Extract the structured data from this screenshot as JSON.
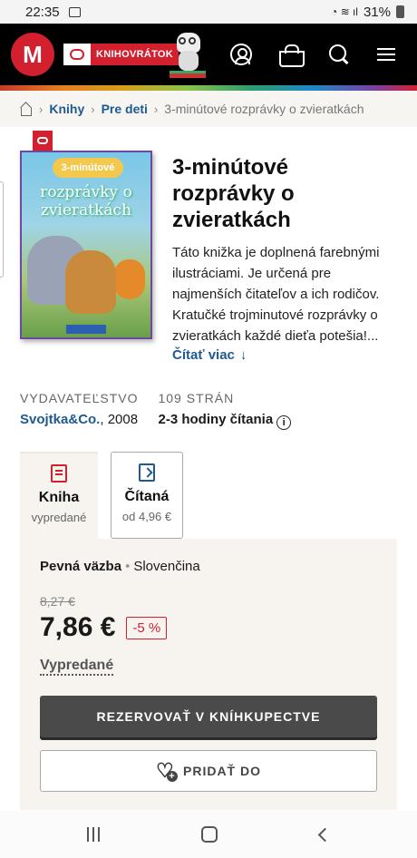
{
  "status_bar": {
    "time": "22:35",
    "battery": "31%"
  },
  "header": {
    "brand_text": "KNIHOVRÁTOK",
    "logo_letter": "M"
  },
  "breadcrumb": {
    "items": [
      {
        "label": "Knihy"
      },
      {
        "label": "Pre deti"
      }
    ],
    "current": "3-minútové rozprávky o zvieratkách"
  },
  "product": {
    "title": "3-minútové rozprávky o zvieratkách",
    "cover_title": "rozprávky o zvieratkách",
    "cover_top": "3-minútové",
    "description": "Táto knižka je doplnená farebnými ilustráciami. Je určená pre najmenších čitateľov a ich rodičov. Kratučké trojminutové rozprávky o zvieratkách každé dieťa potešia!...",
    "read_more": "Čítať viac",
    "publisher_label": "VYDAVATEĽSTVO",
    "publisher": "Svojtka&Co.",
    "year": ", 2008",
    "pages_label": "109 STRÁN",
    "reading_time": "2-3 hodiny čítania"
  },
  "formats": [
    {
      "name": "Kniha",
      "sub": "vypredané"
    },
    {
      "name": "Čítaná",
      "sub": "od 4,96 €"
    }
  ],
  "offer": {
    "binding": "Pevná väzba",
    "language": "Slovenčina",
    "old_price": "8,27 €",
    "price": "7,86 €",
    "discount": "-5 %",
    "availability": "Vypredané",
    "reserve_button": "REZERVOVAŤ V KNÍHKUPECTVE",
    "add_button": "PRIDAŤ DO"
  },
  "colors": {
    "brand_red": "#d3202f",
    "link_blue": "#1f5a8f",
    "button_dark": "#4a4a4a"
  }
}
